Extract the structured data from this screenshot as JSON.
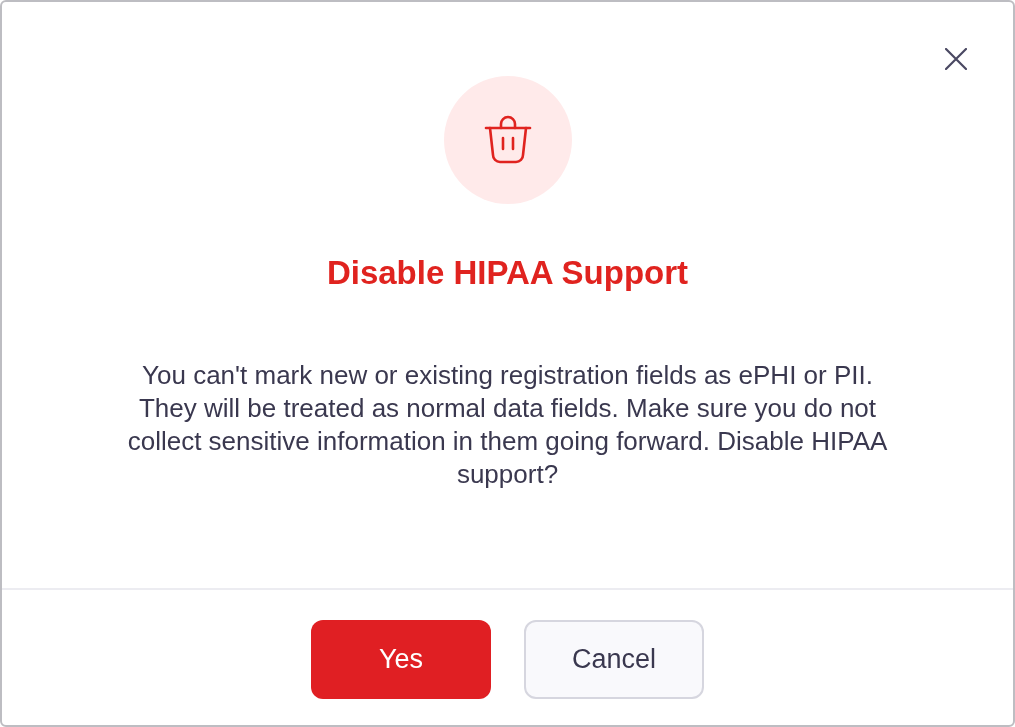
{
  "dialog": {
    "title": "Disable HIPAA Support",
    "message": "You can't mark new or existing registration fields as ePHI or PII. They will be treated as normal data fields. Make sure you do not collect sensitive information in them going forward. Disable HIPAA support?",
    "buttons": [
      {
        "label": "Yes",
        "kind": "primary"
      },
      {
        "label": "Cancel",
        "kind": "secondary"
      }
    ]
  }
}
